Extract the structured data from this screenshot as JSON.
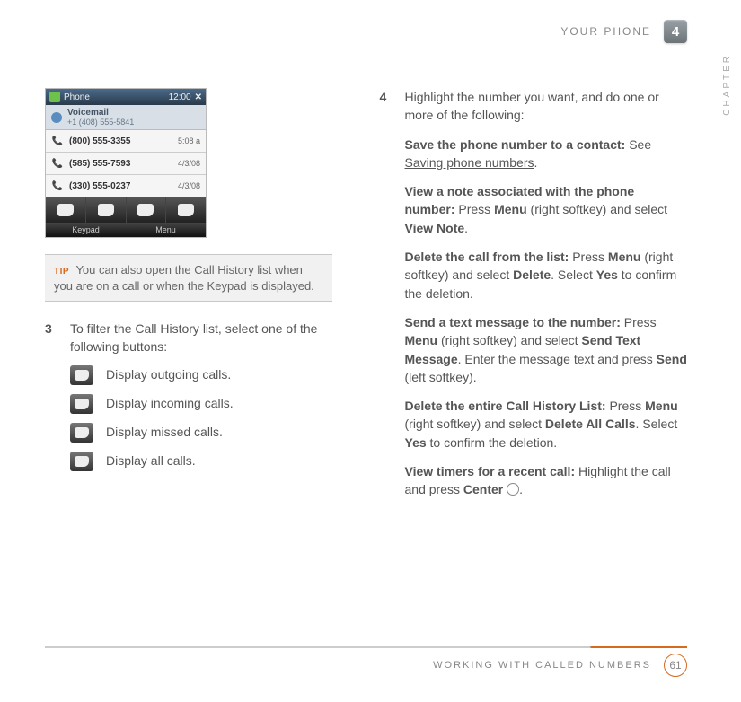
{
  "header": {
    "section": "YOUR PHONE",
    "chapter_number": "4",
    "side_label": "CHAPTER"
  },
  "phone": {
    "title": "Phone",
    "time": "12:00",
    "voicemail": {
      "label": "Voicemail",
      "sub": "+1 (408) 555-5841"
    },
    "rows": [
      {
        "number": "(800) 555-3355",
        "date": "5:08 a"
      },
      {
        "number": "(585) 555-7593",
        "date": "4/3/08"
      },
      {
        "number": "(330) 555-0237",
        "date": "4/3/08"
      }
    ],
    "softkey_left": "Keypad",
    "softkey_right": "Menu"
  },
  "tip": {
    "label": "TIP",
    "text": "You can also open the Call History list when you are on a call or when the Keypad is displayed."
  },
  "step3": {
    "num": "3",
    "intro": "To filter the Call History list, select one of the following buttons:",
    "filters": [
      {
        "label": "Display outgoing calls."
      },
      {
        "label": "Display incoming calls."
      },
      {
        "label": "Display missed calls."
      },
      {
        "label": "Display all calls."
      }
    ]
  },
  "step4": {
    "num": "4",
    "intro": "Highlight the number you want, and do one or more of the following:",
    "items": {
      "save": {
        "title": "Save the phone number to a contact:",
        "pre": "See ",
        "link": "Saving phone numbers",
        "post": "."
      },
      "note": {
        "title": "View a note associated with the phone number:",
        "t1": " Press ",
        "b1": "Menu",
        "t2": " (right softkey) and select ",
        "b2": "View Note",
        "t3": "."
      },
      "del": {
        "title": "Delete the call from the list:",
        "t1": " Press ",
        "b1": "Menu",
        "t2": " (right softkey) and select ",
        "b2": "Delete",
        "t3": ". Select ",
        "b3": "Yes",
        "t4": " to confirm the deletion."
      },
      "sms": {
        "title": "Send a text message to the number:",
        "t1": " Press ",
        "b1": "Menu",
        "t2": " (right softkey) and select ",
        "b2": "Send Text Message",
        "t3": ". Enter the message text and press ",
        "b3": "Send",
        "t4": " (left softkey)."
      },
      "delall": {
        "title": "Delete the entire Call History List:",
        "t1": " Press ",
        "b1": "Menu",
        "t2": " (right softkey) and select ",
        "b2": "Delete All Calls",
        "t3": ". Select ",
        "b3": "Yes",
        "t4": " to confirm the deletion."
      },
      "timers": {
        "title": "View timers for a recent call:",
        "t1": " Highlight the call and press ",
        "b1": "Center",
        "t2": " "
      }
    }
  },
  "footer": {
    "section": "WORKING WITH CALLED NUMBERS",
    "page": "61"
  }
}
